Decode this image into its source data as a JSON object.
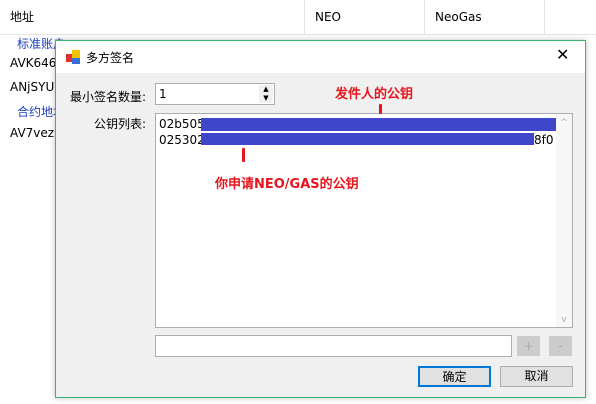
{
  "background_table": {
    "columns": [
      "地址",
      "NEO",
      "NeoGas"
    ],
    "groups": [
      "标准账户",
      "合约地址"
    ],
    "rows": [
      "AVK646",
      "ANjSYU",
      "AV7vez"
    ]
  },
  "dialog": {
    "title": "多方签名",
    "min_sig_label": "最小签名数量:",
    "min_sig_value": "1",
    "pubkey_label": "公钥列表:",
    "pubkeys": [
      "02b505",
      "025302"
    ],
    "pubkey2_suffix": "8f0",
    "add_button": "+",
    "remove_button": "-",
    "ok_button": "确定",
    "cancel_button": "取消",
    "new_key_value": ""
  },
  "annotations": {
    "sender": "发件人的公钥",
    "applicant": "你申请NEO/GAS的公钥",
    "color": "#e8141c"
  }
}
